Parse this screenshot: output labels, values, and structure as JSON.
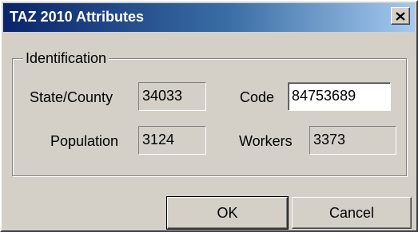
{
  "dialog": {
    "title": "TAZ 2010 Attributes",
    "close_icon": "close-icon"
  },
  "identification": {
    "legend": "Identification",
    "state_county_label": "State/County",
    "state_county_value": "34033",
    "code_label": "Code",
    "code_value": "84753689",
    "population_label": "Population",
    "population_value": "3124",
    "workers_label": "Workers",
    "workers_value": "3373"
  },
  "buttons": {
    "ok_label": "OK",
    "cancel_label": "Cancel"
  }
}
